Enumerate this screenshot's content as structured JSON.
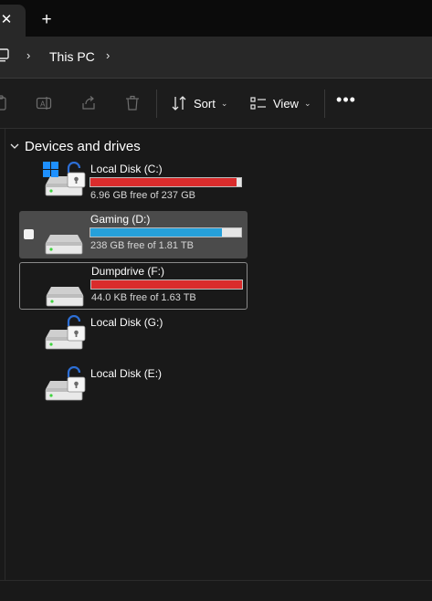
{
  "tabbar": {
    "close_glyph": "✕",
    "new_tab_glyph": "+"
  },
  "address": {
    "location": "This PC",
    "separator": "›"
  },
  "toolbar": {
    "sort_label": "Sort",
    "view_label": "View",
    "more_label": "•••",
    "chevron": "⌄"
  },
  "group": {
    "title": "Devices and drives"
  },
  "drives": [
    {
      "name": "Local Disk (C:)",
      "free": "6.96 GB free of 237 GB",
      "used_fraction": 0.97,
      "bar_color": "#da2c2c",
      "icon": "windows-drive-unlocked-icon",
      "state": "normal"
    },
    {
      "name": "Gaming (D:)",
      "free": "238 GB free of 1.81 TB",
      "used_fraction": 0.87,
      "bar_color": "#26a0da",
      "icon": "drive-icon",
      "state": "selected"
    },
    {
      "name": "Dumpdrive (F:)",
      "free": "44.0 KB free of 1.63 TB",
      "used_fraction": 1.0,
      "bar_color": "#da2c2c",
      "icon": "drive-icon",
      "state": "focused"
    },
    {
      "name": "Local Disk (G:)",
      "free": "",
      "used_fraction": null,
      "bar_color": "",
      "icon": "drive-unlocked-icon",
      "state": "normal"
    },
    {
      "name": "Local Disk (E:)",
      "free": "",
      "used_fraction": null,
      "bar_color": "",
      "icon": "drive-unlocked-icon",
      "state": "normal"
    }
  ],
  "colors": {
    "full_bar": "#da2c2c",
    "normal_bar": "#26a0da",
    "bar_track": "#e6e6e6"
  }
}
